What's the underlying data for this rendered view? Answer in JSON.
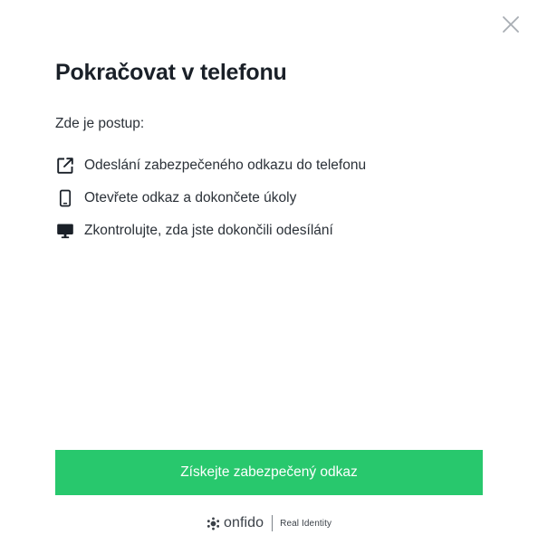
{
  "dialog": {
    "close_icon": "close-icon",
    "title": "Pokračovat v telefonu",
    "intro": "Zde je postup:",
    "steps": [
      {
        "icon": "external-link-icon",
        "label": "Odeslání zabezpečeného odkazu do telefonu"
      },
      {
        "icon": "phone-icon",
        "label": "Otevřete odkaz a dokončete úkoly"
      },
      {
        "icon": "monitor-icon",
        "label": "Zkontrolujte, zda jste dokončili odesílání"
      }
    ],
    "cta_label": "Získejte zabezpečený odkaz"
  },
  "footer": {
    "logo_icon": "onfido-logo-icon",
    "brand": "onfido",
    "tagline": "Real Identity"
  },
  "colors": {
    "accent": "#28c86d",
    "title": "#1a2028",
    "text": "#2b3138",
    "close": "#a8adb3"
  }
}
